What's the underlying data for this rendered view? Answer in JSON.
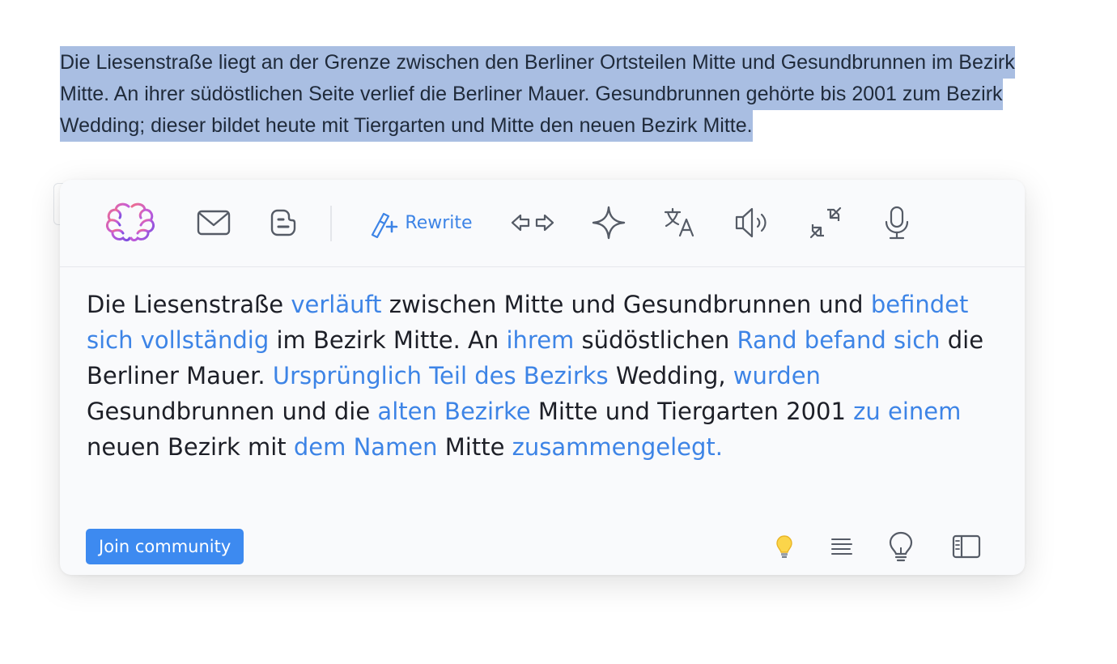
{
  "source_text": "Die Liesenstraße liegt an der Grenze zwischen den Berliner Ortsteilen Mitte und Gesundbrunnen im Bezirk Mitte. An ihrer südöstlichen Seite verlief die Berliner Mauer. Gesundbrunnen gehörte bis 2001 zum Bezirk Wedding; dieser bildet heute mit Tiergarten und Mitte den neuen Bezirk Mitte.",
  "toolbar": {
    "items": [
      {
        "name": "brain-logo-icon",
        "icon": "brain-logo"
      },
      {
        "name": "mail-icon",
        "icon": "envelope"
      },
      {
        "name": "blogger-icon",
        "icon": "blogger"
      },
      {
        "name": "rewrite-icon",
        "icon": "magic-wand-plus"
      },
      {
        "name": "expand-shorten-icon",
        "icon": "arrows-left-right"
      },
      {
        "name": "sparkle-icon",
        "icon": "sparkle"
      },
      {
        "name": "translate-icon",
        "icon": "translate"
      },
      {
        "name": "speaker-icon",
        "icon": "speaker"
      },
      {
        "name": "collapse-arrows-icon",
        "icon": "arrows-in"
      },
      {
        "name": "microphone-icon",
        "icon": "microphone"
      }
    ],
    "rewrite_label": "Rewrite"
  },
  "result": {
    "segments": [
      {
        "text": "Die Liesenstraße ",
        "changed": false
      },
      {
        "text": "verläuft",
        "changed": true
      },
      {
        "text": " zwischen Mitte und Gesundbrunnen und ",
        "changed": false
      },
      {
        "text": "befindet sich vollständig",
        "changed": true
      },
      {
        "text": " im Bezirk Mitte. An ",
        "changed": false
      },
      {
        "text": "ihrem",
        "changed": true
      },
      {
        "text": " südöstlichen ",
        "changed": false
      },
      {
        "text": "Rand befand sich",
        "changed": true
      },
      {
        "text": " die Berliner Mauer. ",
        "changed": false
      },
      {
        "text": "Ursprünglich Teil des Bezirks",
        "changed": true
      },
      {
        "text": " Wedding, ",
        "changed": false
      },
      {
        "text": "wurden",
        "changed": true
      },
      {
        "text": " Gesundbrunnen und die ",
        "changed": false
      },
      {
        "text": "alten Bezirke",
        "changed": true
      },
      {
        "text": " Mitte und Tiergarten 2001 ",
        "changed": false
      },
      {
        "text": "zu einem",
        "changed": true
      },
      {
        "text": " neuen Bezirk mit ",
        "changed": false
      },
      {
        "text": "dem Namen",
        "changed": true
      },
      {
        "text": " Mitte ",
        "changed": false
      },
      {
        "text": "zusammengelegt.",
        "changed": true
      }
    ]
  },
  "footer": {
    "join_label": "Join community",
    "icons": [
      "lightbulb-color-icon",
      "align-left-icon",
      "lightbulb-outline-icon",
      "sidebar-icon"
    ]
  },
  "colors": {
    "accent": "#3d84e6",
    "selection": "#a9bee2",
    "button": "#3d8af0"
  }
}
